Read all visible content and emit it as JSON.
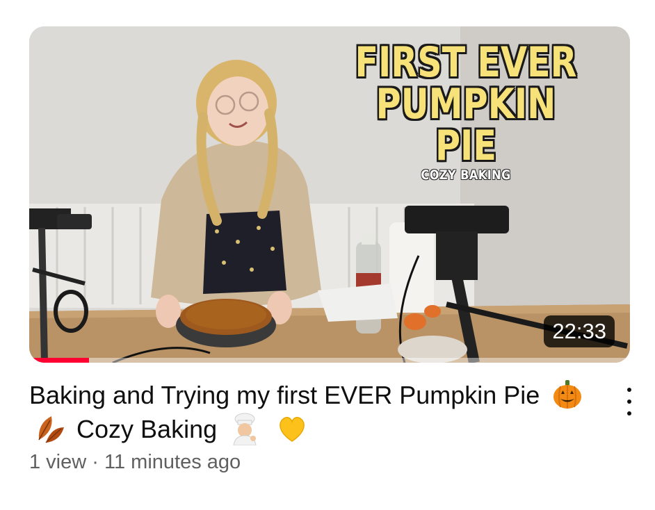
{
  "video": {
    "thumbnail": {
      "overlay_title_line1": "FIRST EVER",
      "overlay_title_line2": "PUMPKIN PIE",
      "overlay_subtitle": "COZY BAKING",
      "duration": "22:33",
      "watch_progress": 0.1
    },
    "title_text_1": "Baking and Trying my first EVER Pumpkin Pie",
    "title_text_2": "Cozy Baking",
    "title_emojis": [
      "pumpkin-icon",
      "fallen-leaf-icon",
      "baker-icon",
      "yellow-heart-icon"
    ],
    "views": "1 view",
    "separator": "·",
    "age": "11 minutes ago"
  },
  "colors": {
    "progress": "#ff0033",
    "title_text": "#0f0f0f",
    "meta_text": "#606060",
    "overlay_yellow": "#f7e27a"
  }
}
